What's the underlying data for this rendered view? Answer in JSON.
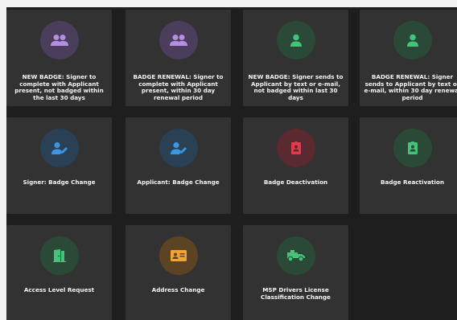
{
  "cards": [
    {
      "label": "NEW BADGE: Signer to complete with Applicant present, not badged within the last 30 days",
      "icon": "people-icon",
      "color": "#b48ee0"
    },
    {
      "label": "BADGE RENEWAL: Signer to complete with Applicant present, within 30 day renewal period",
      "icon": "people-icon",
      "color": "#b48ee0"
    },
    {
      "label": "NEW BADGE: Signer sends to Applicant by text or e-mail, not badged within last 30 days",
      "icon": "person-icon",
      "color": "#46c27a"
    },
    {
      "label": "BADGE RENEWAL: Signer sends to Applicant by text or e-mail, within 30 day renewal period",
      "icon": "person-icon",
      "color": "#46c27a"
    },
    {
      "label": "Signer: Badge Change",
      "icon": "person-edit-icon",
      "color": "#3d96e0"
    },
    {
      "label": "Applicant: Badge Change",
      "icon": "person-edit-icon",
      "color": "#3d96e0"
    },
    {
      "label": "Badge Deactivation",
      "icon": "badge-icon",
      "color": "#e23b4b"
    },
    {
      "label": "Badge Reactivation",
      "icon": "badge-icon",
      "color": "#46c27a"
    },
    {
      "label": "Access Level Request",
      "icon": "door-icon",
      "color": "#46c27a"
    },
    {
      "label": "Address Change",
      "icon": "id-card-icon",
      "color": "#f1a433"
    },
    {
      "label": "MSP Drivers License Classification Change",
      "icon": "truck-icon",
      "color": "#46c27a"
    }
  ]
}
